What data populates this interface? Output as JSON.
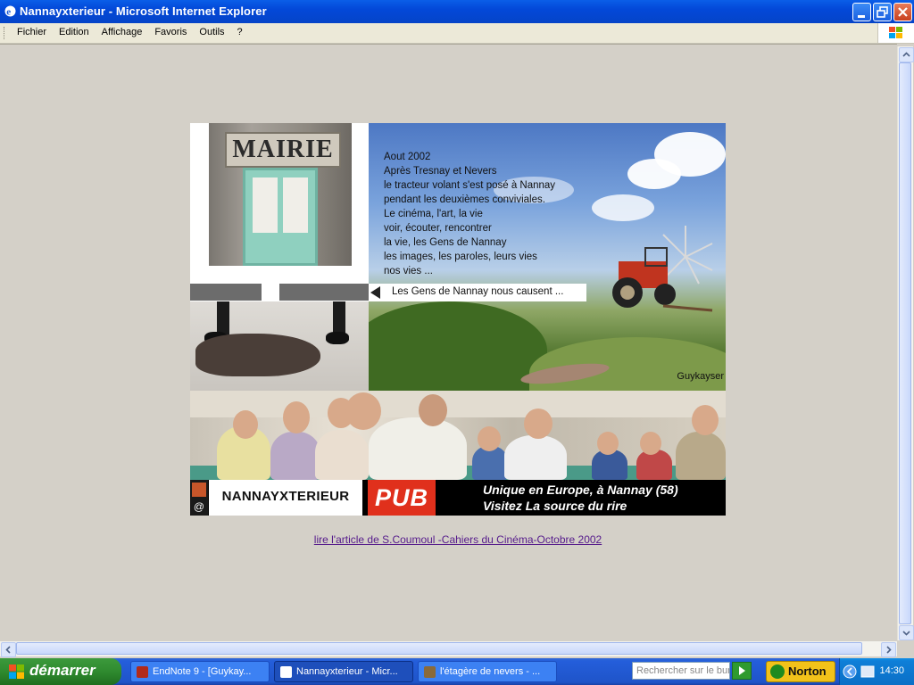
{
  "window": {
    "title": "Nannayxterieur - Microsoft Internet Explorer"
  },
  "menu": {
    "items": [
      "Fichier",
      "Edition",
      "Affichage",
      "Favoris",
      "Outils",
      "?"
    ]
  },
  "page": {
    "mairie_sign": "MAIRIE",
    "intro_lines": [
      "Aout 2002",
      "Après Tresnay et Nevers",
      "le tracteur  volant s'est posé à Nannay",
      "pendant les deuxièmes conviviales.",
      "Le cinéma, l'art, la vie",
      "voir, écouter, rencontrer",
      "la vie, les Gens de Nannay",
      "les images, les paroles, leurs vies",
      "nos vies ..."
    ],
    "tagline": "Les Gens de Nannay nous causent ...",
    "photo_credit": "Guykayser",
    "site_name": "NANNAYXTERIEUR",
    "logo_at": "@",
    "pub_label": "PUB",
    "pub_lines": [
      "Unique en Europe, à Nannay (58)",
      "Visitez La source du rire"
    ],
    "article_link": "lire l'article de S.Coumoul -Cahiers du Cinéma-Octobre 2002"
  },
  "taskbar": {
    "start_label": "démarrer",
    "tasks": [
      {
        "label": "EndNote 9 - [Guykay...",
        "active": false
      },
      {
        "label": "Nannayxterieur - Micr...",
        "active": true
      },
      {
        "label": "l'étagère de nevers - ...",
        "active": false
      }
    ],
    "search_placeholder": "Rechercher sur le bur",
    "norton_label": "Norton",
    "clock": "14:30"
  },
  "colors": {
    "titlebar": "#0348d8",
    "pub_red": "#e0301c",
    "start_green": "#2f8a2f",
    "link_visited": "#551a8b"
  }
}
